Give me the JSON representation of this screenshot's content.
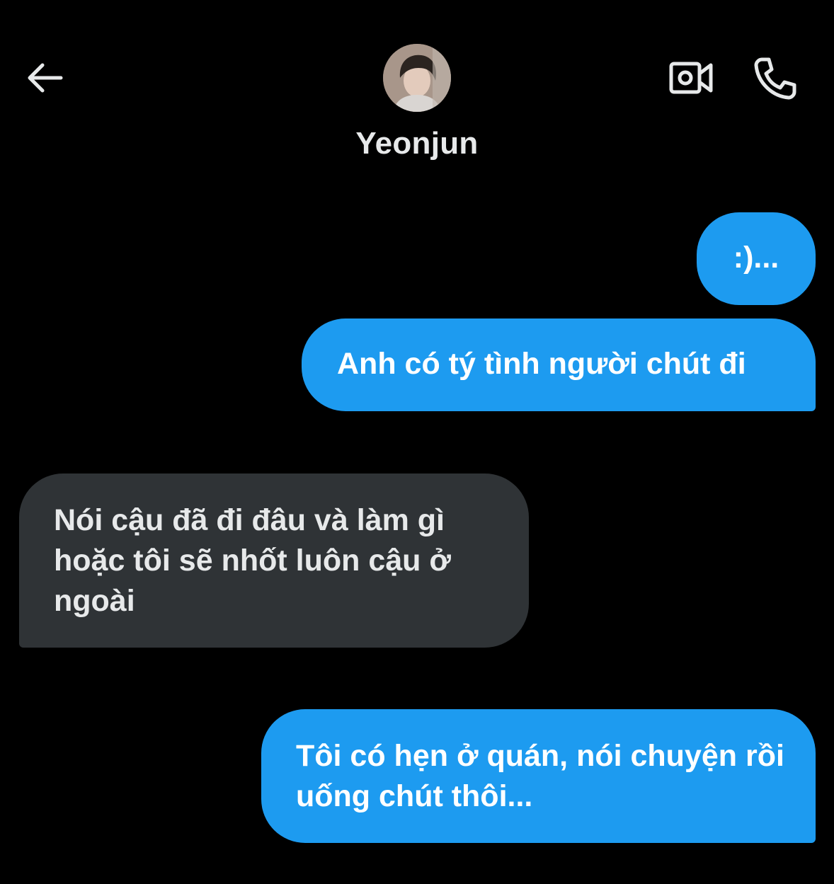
{
  "header": {
    "contact_name": "Yeonjun",
    "back_icon": "arrow-left-icon",
    "video_icon": "video-camera-icon",
    "call_icon": "phone-icon"
  },
  "colors": {
    "background": "#000000",
    "sent_bubble": "#1d9bf0",
    "received_bubble": "#2f3336",
    "text": "#e7e9ea"
  },
  "messages": [
    {
      "direction": "sent",
      "text": ":)..."
    },
    {
      "direction": "sent",
      "text": "Anh có tý tình người chút đi"
    },
    {
      "direction": "received",
      "text": "Nói cậu đã đi đâu và làm gì hoặc tôi sẽ nhốt luôn cậu ở ngoài"
    },
    {
      "direction": "sent",
      "text": "Tôi có hẹn ở quán, nói chuyện rồi uống chút thôi..."
    }
  ]
}
